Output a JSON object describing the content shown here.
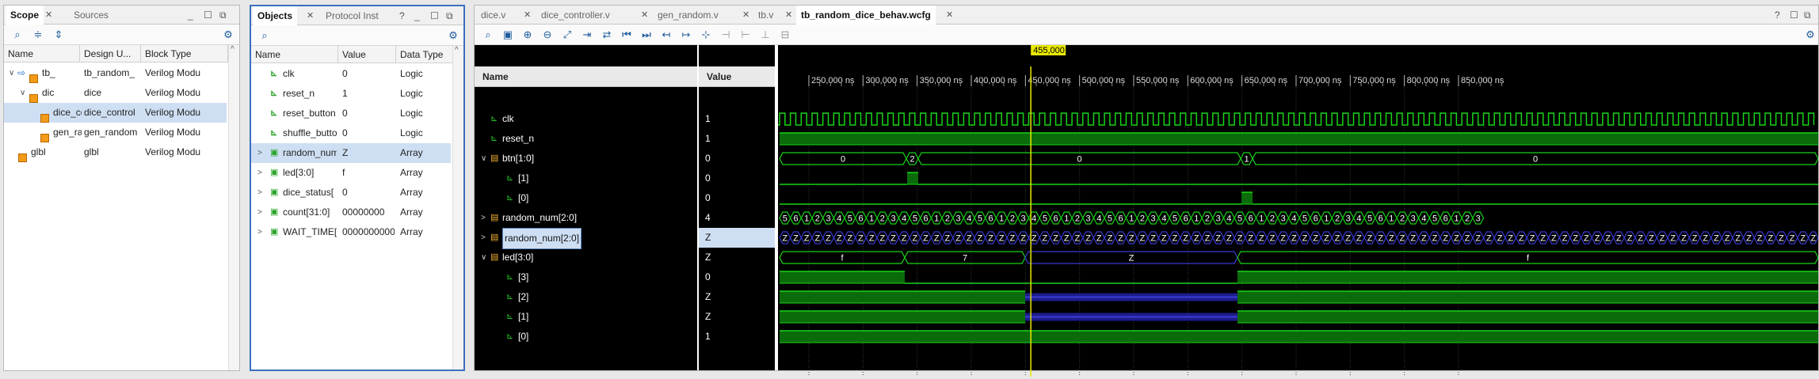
{
  "scope": {
    "tabs": [
      "Scope",
      "Sources"
    ],
    "columns": [
      "Name",
      "Design U...",
      "Block Type"
    ],
    "rows": [
      {
        "name": "tb_",
        "unit": "tb_random_",
        "type": "Verilog Modu",
        "expand": "v",
        "indent": 0,
        "icon": "arrow-module"
      },
      {
        "name": "dic",
        "unit": "dice",
        "type": "Verilog Modu",
        "expand": "v",
        "indent": 1,
        "icon": "module"
      },
      {
        "name": "dice_control",
        "unit": "dice_control",
        "type": "Verilog Modu",
        "expand": "",
        "indent": 2,
        "icon": "module",
        "selected": true
      },
      {
        "name": "gen_random",
        "unit": "gen_random",
        "type": "Verilog Modu",
        "expand": "",
        "indent": 2,
        "icon": "module"
      },
      {
        "name": "glbl",
        "unit": "glbl",
        "type": "Verilog Modu",
        "expand": "",
        "indent": 0,
        "icon": "module"
      }
    ]
  },
  "objects": {
    "tabs": [
      "Objects",
      "Protocol Inst"
    ],
    "columns": [
      "Name",
      "Value",
      "Data Type"
    ],
    "rows": [
      {
        "name": "clk",
        "value": "0",
        "type": "Logic",
        "expand": ""
      },
      {
        "name": "reset_n",
        "value": "1",
        "type": "Logic",
        "expand": ""
      },
      {
        "name": "reset_button",
        "value": "0",
        "type": "Logic",
        "expand": ""
      },
      {
        "name": "shuffle_button",
        "value": "0",
        "type": "Logic",
        "expand": ""
      },
      {
        "name": "random_num",
        "value": "Z",
        "type": "Array",
        "expand": ">",
        "selected": true
      },
      {
        "name": "led[3:0]",
        "value": "f",
        "type": "Array",
        "expand": ">"
      },
      {
        "name": "dice_status[",
        "value": "0",
        "type": "Array",
        "expand": ">"
      },
      {
        "name": "count[31:0]",
        "value": "00000000",
        "type": "Array",
        "expand": ">"
      },
      {
        "name": "WAIT_TIME[",
        "value": "0000000000",
        "type": "Array",
        "expand": ">"
      }
    ]
  },
  "wave": {
    "tabs": [
      "dice.v",
      "dice_controller.v",
      "gen_random.v",
      "tb.v",
      "tb_random_dice_behav.wcfg"
    ],
    "name_header": "Name",
    "value_header": "Value",
    "cursor_label": "455,000 ns",
    "time_ticks": [
      "250,000 ns",
      "300,000 ns",
      "350,000 ns",
      "400,000 ns",
      "450,000 ns",
      "500,000 ns",
      "550,000 ns",
      "600,000 ns",
      "650,000 ns",
      "700,000 ns",
      "750,000 ns",
      "800,000 ns",
      "850,000 ns"
    ],
    "signals": [
      {
        "name": "clk",
        "value": "1",
        "expand": "",
        "indent": 0,
        "kind": "bit"
      },
      {
        "name": "reset_n",
        "value": "1",
        "expand": "",
        "indent": 0,
        "kind": "bit"
      },
      {
        "name": "btn[1:0]",
        "value": "0",
        "expand": "v",
        "indent": 0,
        "kind": "bus"
      },
      {
        "name": "[1]",
        "value": "0",
        "expand": "",
        "indent": 1,
        "kind": "bit"
      },
      {
        "name": "[0]",
        "value": "0",
        "expand": "",
        "indent": 1,
        "kind": "bit"
      },
      {
        "name": "random_num[2:0]",
        "value": "4",
        "expand": ">",
        "indent": 0,
        "kind": "bus"
      },
      {
        "name": "random_num[2:0]",
        "value": "Z",
        "expand": ">",
        "indent": 0,
        "kind": "bus",
        "selected": true
      },
      {
        "name": "led[3:0]",
        "value": "Z",
        "expand": "v",
        "indent": 0,
        "kind": "bus"
      },
      {
        "name": "[3]",
        "value": "0",
        "expand": "",
        "indent": 1,
        "kind": "bit"
      },
      {
        "name": "[2]",
        "value": "Z",
        "expand": "",
        "indent": 1,
        "kind": "bit"
      },
      {
        "name": "[1]",
        "value": "Z",
        "expand": "",
        "indent": 1,
        "kind": "bit"
      },
      {
        "name": "[0]",
        "value": "1",
        "expand": "",
        "indent": 1,
        "kind": "bit"
      }
    ],
    "btn_labels": [
      "0",
      "2",
      "0",
      "1",
      "0"
    ],
    "random_seq_start": [
      "5",
      "6",
      "1",
      "2",
      "3",
      "4",
      "5",
      "6",
      "1",
      "2",
      "3",
      "4",
      "5",
      "6",
      "1",
      "2",
      "3",
      "4",
      "5",
      "6",
      "1",
      "2",
      "3",
      "4",
      "5",
      "6",
      "1",
      "2",
      "3",
      "4",
      "5",
      "6",
      "1",
      "2",
      "3",
      "4",
      "5",
      "6",
      "1",
      "2",
      "3",
      "4",
      "5",
      "6",
      "1",
      "2",
      "3",
      "4",
      "5",
      "6",
      "1",
      "2",
      "3",
      "4",
      "5",
      "6",
      "1",
      "2",
      "3",
      "4",
      "5",
      "6",
      "1",
      "2",
      "3"
    ],
    "z_label": "Z",
    "led_labels": [
      "f",
      "7",
      "Z",
      "f"
    ],
    "colors": {
      "wave": "#18d418",
      "high_fill": "#0b6b0b",
      "z": "#3b3bd6",
      "cursor": "#e8e800",
      "grid": "#3a3a3a"
    }
  }
}
